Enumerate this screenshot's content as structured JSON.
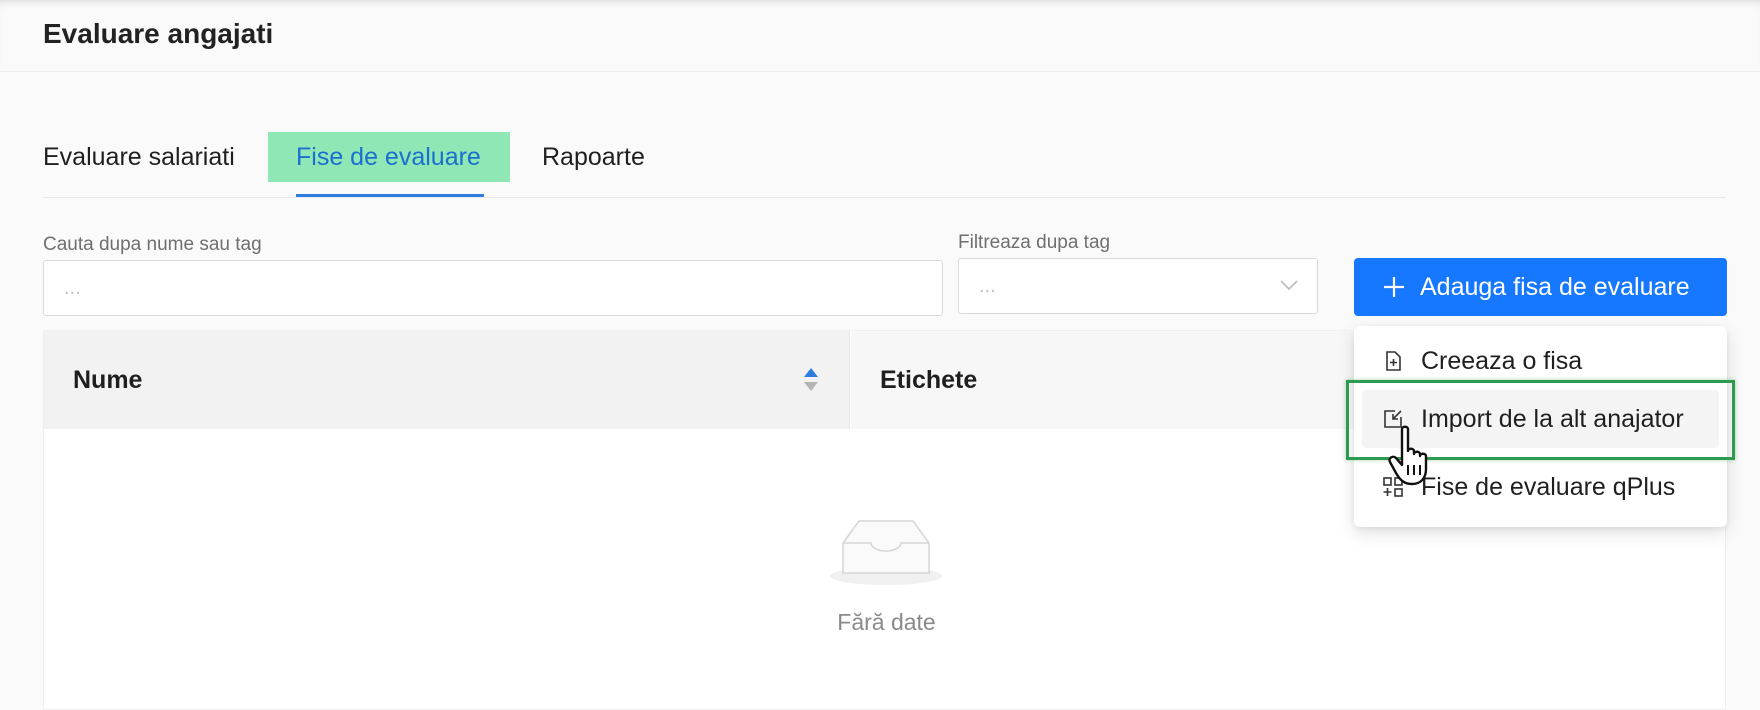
{
  "header": {
    "title": "Evaluare angajati"
  },
  "tabs": [
    {
      "label": "Evaluare salariati"
    },
    {
      "label": "Fise de evaluare",
      "active": true
    },
    {
      "label": "Rapoarte"
    }
  ],
  "filters": {
    "search_label": "Cauta dupa nume sau tag",
    "search_placeholder": "...",
    "tag_label": "Filtreaza dupa tag",
    "tag_placeholder": "..."
  },
  "add_button": {
    "label": "Adauga fisa de evaluare",
    "icon": "plus-icon"
  },
  "dropdown": {
    "items": [
      {
        "label": "Creeaza o fisa",
        "icon": "file-add-icon"
      },
      {
        "label": "Import de la alt anajator",
        "icon": "import-icon"
      },
      {
        "label": "Fise de evaluare qPlus",
        "icon": "apps-add-icon"
      }
    ]
  },
  "table": {
    "columns": [
      "Nume",
      "Etichete"
    ],
    "empty_text": "Fără date"
  },
  "colors": {
    "accent": "#1677ff",
    "active_tab_bg": "#8fe7b5",
    "highlight": "#2e9a4e"
  }
}
